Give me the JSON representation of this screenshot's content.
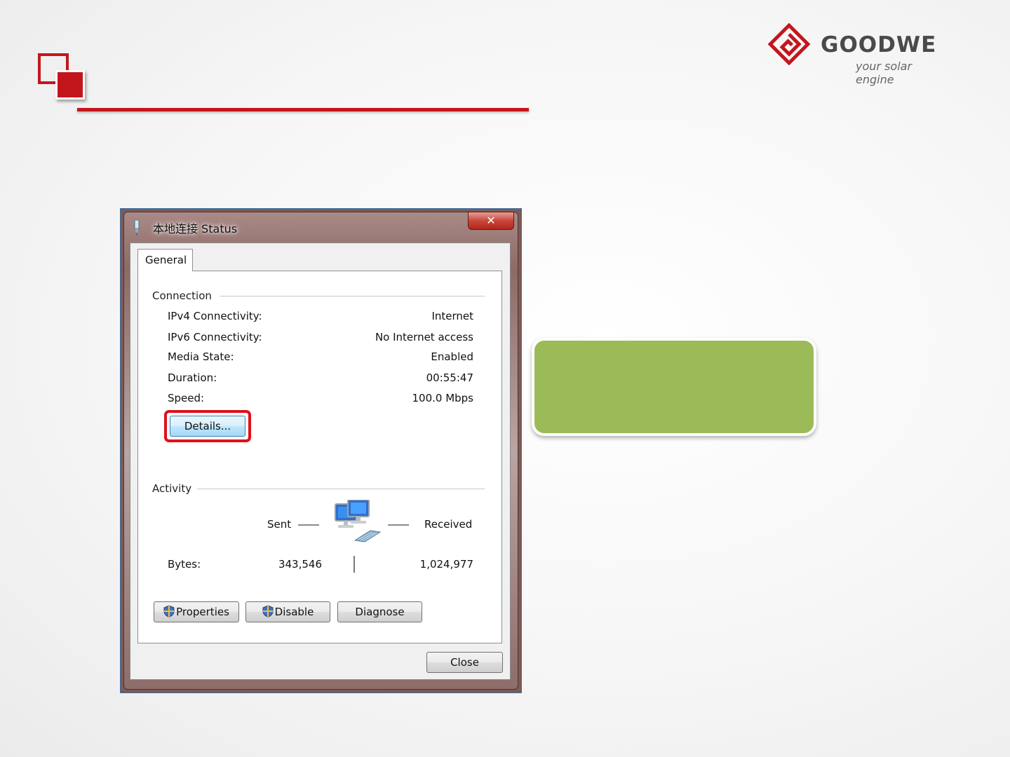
{
  "logo": {
    "wordmark": "GOODWE",
    "tagline": "your solar engine",
    "brand_color": "#c3161c"
  },
  "callout": {
    "color": "#9bbb59",
    "text": ""
  },
  "dialog": {
    "title": "本地连接 Status",
    "title_icon": "network-connection-icon",
    "close_glyph": "✕",
    "tabs": [
      {
        "label": "General"
      }
    ],
    "connection": {
      "heading": "Connection",
      "rows": [
        {
          "label": "IPv4 Connectivity:",
          "value": "Internet"
        },
        {
          "label": "IPv6 Connectivity:",
          "value": "No Internet access"
        },
        {
          "label": "Media State:",
          "value": "Enabled"
        },
        {
          "label": "Duration:",
          "value": "00:55:47"
        },
        {
          "label": "Speed:",
          "value": "100.0 Mbps"
        }
      ],
      "details_button": "Details..."
    },
    "activity": {
      "heading": "Activity",
      "sent_label": "Sent",
      "received_label": "Received",
      "bytes_label": "Bytes:",
      "bytes_sent": "343,546",
      "bytes_received": "1,024,977",
      "icon": "network-computers-icon"
    },
    "buttons": {
      "properties": "Properties",
      "disable": "Disable",
      "diagnose": "Diagnose",
      "close": "Close"
    }
  }
}
